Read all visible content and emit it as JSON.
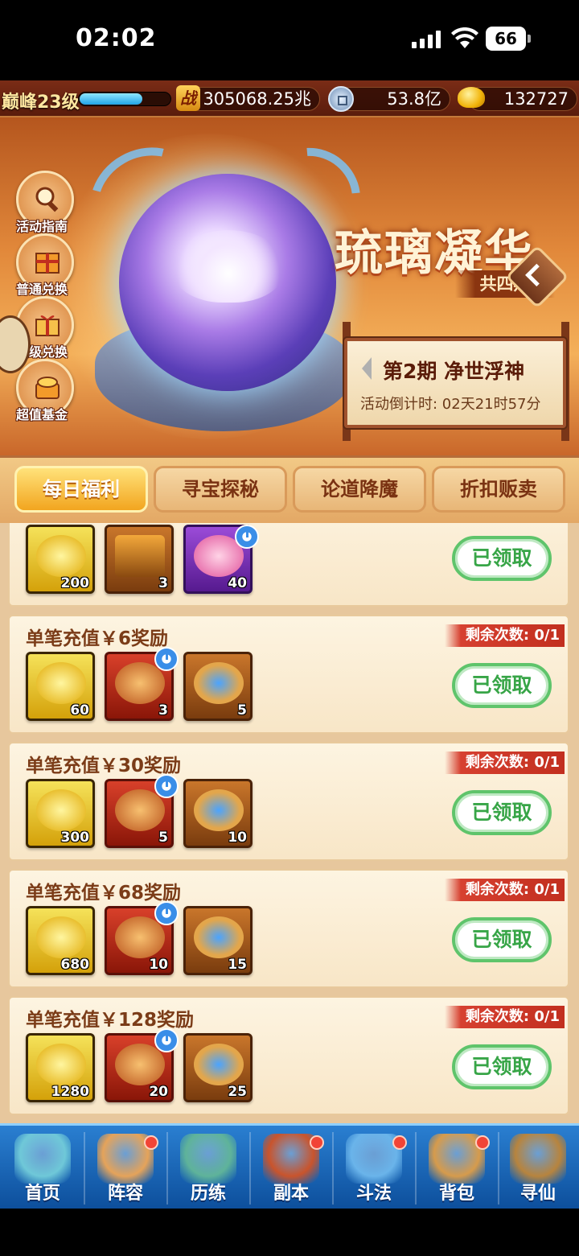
{
  "status_bar": {
    "time": "02:02",
    "battery": "66"
  },
  "resources": {
    "level_label": "巅峰23级",
    "xp_fraction": 0.7,
    "power_badge": "战",
    "combat_power": "305068.25兆",
    "silver": "53.8亿",
    "gold": "132727"
  },
  "banner": {
    "title": "琉璃凝华",
    "subtitle": "共四期",
    "period_title": "第2期  净世浮神",
    "countdown": "活动倒计时: 02天21时57分",
    "side_buttons": [
      {
        "label": "活动指南",
        "icon": "magnifier-icon"
      },
      {
        "label": "普通兑换",
        "icon": "gift-box-icon"
      },
      {
        "label": "高级兑换",
        "icon": "gift-icon"
      },
      {
        "label": "超值基金",
        "icon": "treasure-icon"
      }
    ]
  },
  "tabs": [
    {
      "label": "每日福利",
      "active": true
    },
    {
      "label": "寻宝探秘",
      "active": false
    },
    {
      "label": "论道降魔",
      "active": false
    },
    {
      "label": "折扣贩卖",
      "active": false
    }
  ],
  "cards": [
    {
      "title": "",
      "remaining": "",
      "button": "已领取",
      "items": [
        {
          "type": "gold",
          "qty": "200",
          "timed": false
        },
        {
          "type": "orange",
          "qty": "3",
          "timed": false
        },
        {
          "type": "purple",
          "qty": "40",
          "timed": true
        }
      ]
    },
    {
      "title": "单笔充值￥6奖励",
      "remaining": "剩余次数: 0/1",
      "button": "已领取",
      "items": [
        {
          "type": "gold",
          "qty": "60",
          "timed": false
        },
        {
          "type": "red",
          "qty": "3",
          "timed": true
        },
        {
          "type": "orange",
          "qty": "5",
          "timed": false
        }
      ]
    },
    {
      "title": "单笔充值￥30奖励",
      "remaining": "剩余次数: 0/1",
      "button": "已领取",
      "items": [
        {
          "type": "gold",
          "qty": "300",
          "timed": false
        },
        {
          "type": "red",
          "qty": "5",
          "timed": true
        },
        {
          "type": "orange",
          "qty": "10",
          "timed": false
        }
      ]
    },
    {
      "title": "单笔充值￥68奖励",
      "remaining": "剩余次数: 0/1",
      "button": "已领取",
      "items": [
        {
          "type": "gold",
          "qty": "680",
          "timed": false
        },
        {
          "type": "red",
          "qty": "10",
          "timed": true
        },
        {
          "type": "orange",
          "qty": "15",
          "timed": false
        }
      ]
    },
    {
      "title": "单笔充值￥128奖励",
      "remaining": "剩余次数: 0/1",
      "button": "已领取",
      "items": [
        {
          "type": "gold",
          "qty": "1280",
          "timed": false
        },
        {
          "type": "red",
          "qty": "20",
          "timed": true
        },
        {
          "type": "orange",
          "qty": "25",
          "timed": false
        }
      ]
    }
  ],
  "bottom_nav": [
    {
      "label": "首页",
      "dot": false,
      "color": "#6fc8d8"
    },
    {
      "label": "阵容",
      "dot": true,
      "color": "#e5a35a"
    },
    {
      "label": "历练",
      "dot": false,
      "color": "#5fb39a"
    },
    {
      "label": "副本",
      "dot": true,
      "color": "#c9542c"
    },
    {
      "label": "斗法",
      "dot": true,
      "color": "#6ab4ea"
    },
    {
      "label": "背包",
      "dot": true,
      "color": "#d69b4c"
    },
    {
      "label": "寻仙",
      "dot": false,
      "color": "#b7843e"
    }
  ],
  "colors": {
    "accent": "#f2a51f",
    "claimed_green": "#37a547",
    "remain_red": "#d64030"
  }
}
